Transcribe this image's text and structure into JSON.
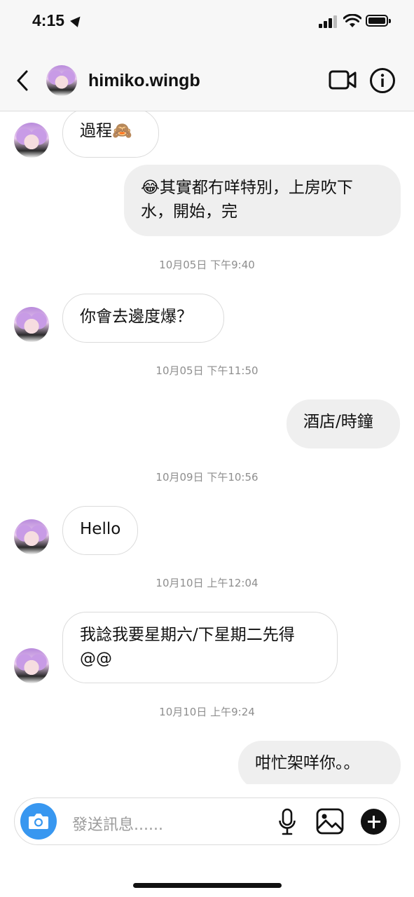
{
  "status_bar": {
    "time": "4:15"
  },
  "header": {
    "username": "himiko.wingb"
  },
  "messages": [
    {
      "text": "過程🙈"
    },
    {
      "text": "😂其實都冇咩特別，上房吹下水，開始，完"
    },
    {
      "timestamp": "10月05日 下午9:40"
    },
    {
      "text": "你會去邊度爆？"
    },
    {
      "timestamp": "10月05日 下午11:50"
    },
    {
      "text": "酒店/時鐘"
    },
    {
      "timestamp": "10月09日 下午10:56"
    },
    {
      "text": "Hello"
    },
    {
      "timestamp": "10月10日 上午12:04"
    },
    {
      "text": "我諗我要星期六/下星期二先得@@"
    },
    {
      "timestamp": "10月10日 上午9:24"
    },
    {
      "text": "咁忙架咩你。。"
    }
  ],
  "composer": {
    "placeholder": "發送訊息......"
  },
  "colors": {
    "accent": "#3897f0",
    "incoming_border": "#dbdbdb",
    "outgoing_bg": "#efefef",
    "timestamp": "#8e8e8e"
  },
  "icons": {
    "back": "chevron-left-icon",
    "video": "video-camera-icon",
    "info": "info-icon",
    "camera": "camera-icon",
    "mic": "microphone-icon",
    "gallery": "gallery-icon",
    "plus": "plus-icon"
  }
}
